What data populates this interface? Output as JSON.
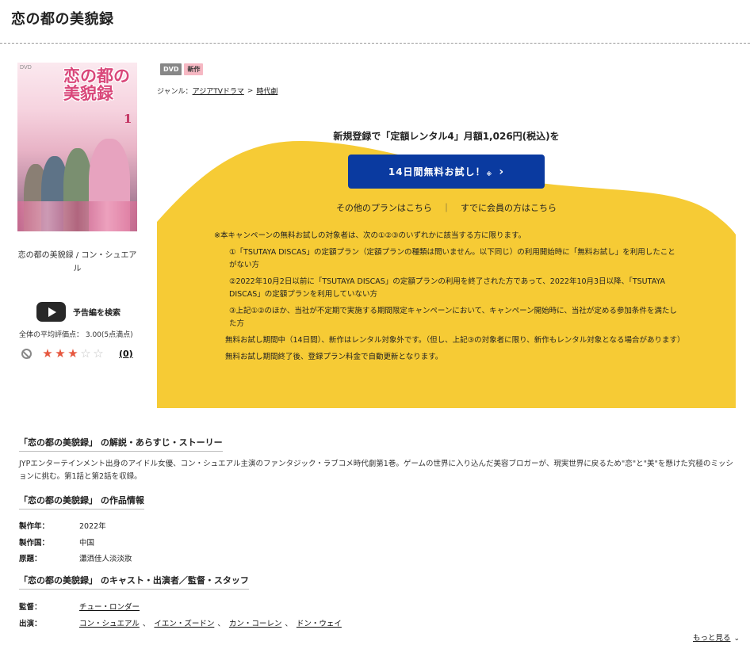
{
  "page": {
    "title": "恋の都の美貌録"
  },
  "cover": {
    "logo": "恋の都の美貌録",
    "volume": "1",
    "dvd_mark": "DVD"
  },
  "work_caption": "恋の都の美貌録 / コン・シュエアル",
  "trailer": {
    "label": "予告編を検索",
    "icon": "youtube-play-icon"
  },
  "rating": {
    "text": "全体の平均評価点： 3.00(5点満点)",
    "value": 3,
    "max": 5,
    "review_count": "(0)",
    "color_on": "#e6573f",
    "color_off": "#c4c4c4"
  },
  "badges": {
    "dvd": "DVD",
    "new": "新作"
  },
  "genre": {
    "label": "ジャンル：",
    "path": [
      "アジアTVドラマ",
      "時代劇"
    ],
    "separator": ">"
  },
  "promo": {
    "headline": "新規登録で「定額レンタル4」月額1,026円(税込)を",
    "button_label": "14日間無料お試し！",
    "button_sup": "※",
    "other_plans": "その他のプランはこちら",
    "divider": "｜",
    "members": "すでに会員の方はこちら",
    "colors": {
      "yellow": "#f6cb35",
      "button": "#0a3aa0"
    }
  },
  "notes": {
    "lead": "※本キャンペーンの無料お試しの対象者は、次の①②③のいずれかに該当する方に限ります。",
    "item1": "①「TSUTAYA DISCAS」の定額プラン（定額プランの種類は問いません。以下同じ）の利用開始時に「無料お試し」を利用したことがない方",
    "item2": "②2022年10月2日以前に「TSUTAYA DISCAS」の定額プランの利用を終了された方であって、2022年10月3日以降、「TSUTAYA DISCAS」の定額プランを利用していない方",
    "item3": "③上記①②のほか、当社が不定期で実施する期間限定キャンペーンにおいて、キャンペーン開始時に、当社が定める参加条件を満たした方",
    "period": "無料お試し期間中（14日間）、新作はレンタル対象外です。（但し、上記③の対象者に限り、新作もレンタル対象となる場合があります）",
    "renewal": "無料お試し期間終了後、登録プラン料金で自動更新となります。"
  },
  "synopsis": {
    "heading": "「恋の都の美貌録」 の解説・あらすじ・ストーリー",
    "text": "JYPエンターテインメント出身のアイドル女優、コン・シュエアル主演のファンタジック・ラブコメ時代劇第1巻。ゲームの世界に入り込んだ美容ブロガーが、現実世界に戻るため\"恋\"と\"美\"を懸けた究極のミッションに挑む。第1話と第2話を収録。"
  },
  "work_info": {
    "heading": "「恋の都の美貌録」 の作品情報",
    "rows": [
      {
        "label": "製作年：",
        "value": "2022年"
      },
      {
        "label": "製作国：",
        "value": "中国"
      },
      {
        "label": "原題：",
        "value": "瀟洒佳人淡淡妝"
      }
    ]
  },
  "cast": {
    "heading": "「恋の都の美貌録」 のキャスト・出演者／監督・スタッフ",
    "director_label": "監督：",
    "director": "チュー・ロンダー",
    "cast_label": "出演：",
    "members": [
      "コン・シュエアル",
      "イエン・ズードン",
      "カン・コーレン",
      "ドン・ウェイ"
    ],
    "comma": "、"
  },
  "more": {
    "label": "もっと見る"
  }
}
